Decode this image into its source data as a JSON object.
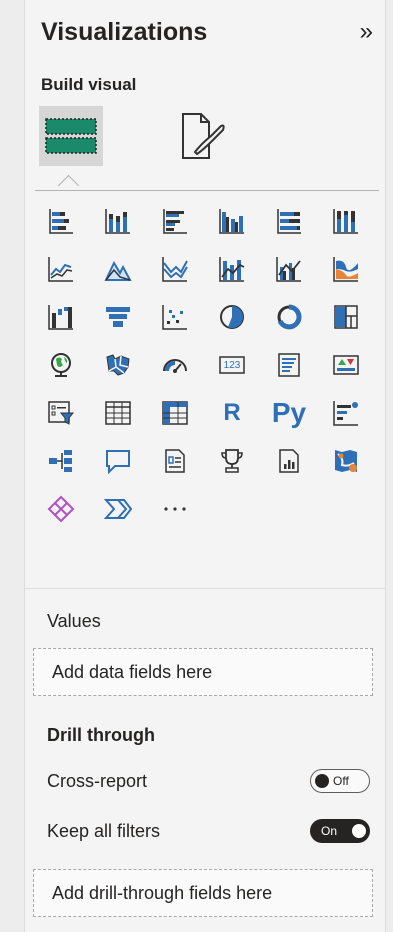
{
  "pane": {
    "title": "Visualizations",
    "subtitle": "Build visual"
  },
  "icons": [
    "stacked-bar-chart-icon",
    "stacked-column-chart-icon",
    "clustered-bar-chart-icon",
    "clustered-column-chart-icon",
    "100-stacked-bar-chart-icon",
    "100-stacked-column-chart-icon",
    "line-chart-icon",
    "area-chart-icon",
    "stacked-area-chart-icon",
    "line-stacked-column-chart-icon",
    "line-clustered-column-chart-icon",
    "ribbon-chart-icon",
    "waterfall-chart-icon",
    "funnel-icon",
    "scatter-chart-icon",
    "pie-chart-icon",
    "donut-chart-icon",
    "treemap-icon",
    "map-icon",
    "filled-map-icon",
    "gauge-icon",
    "card-icon",
    "multi-row-card-icon",
    "kpi-icon",
    "slicer-icon",
    "table-icon",
    "matrix-icon",
    "r-script-visual-icon",
    "python-visual-icon",
    "key-influencers-icon",
    "decomposition-tree-icon",
    "qa-icon",
    "narrative-icon",
    "metrics-icon",
    "paginated-report-icon",
    "azure-map-icon",
    "power-apps-icon",
    "power-automate-icon",
    "more-visuals-icon"
  ],
  "text_icons": {
    "r": "R",
    "py": "Py",
    "card": "123"
  },
  "values": {
    "label": "Values",
    "placeholder": "Add data fields here"
  },
  "drill": {
    "title": "Drill through",
    "cross_report": {
      "label": "Cross-report",
      "state": "Off"
    },
    "keep_filters": {
      "label": "Keep all filters",
      "state": "On"
    },
    "placeholder": "Add drill-through fields here"
  },
  "colors": {
    "accent_blue": "#2f6fb6",
    "teal": "#1a8a8a",
    "green": "#3aa64c",
    "orange": "#e8833a",
    "purple": "#b24fc4",
    "text": "#252423"
  }
}
